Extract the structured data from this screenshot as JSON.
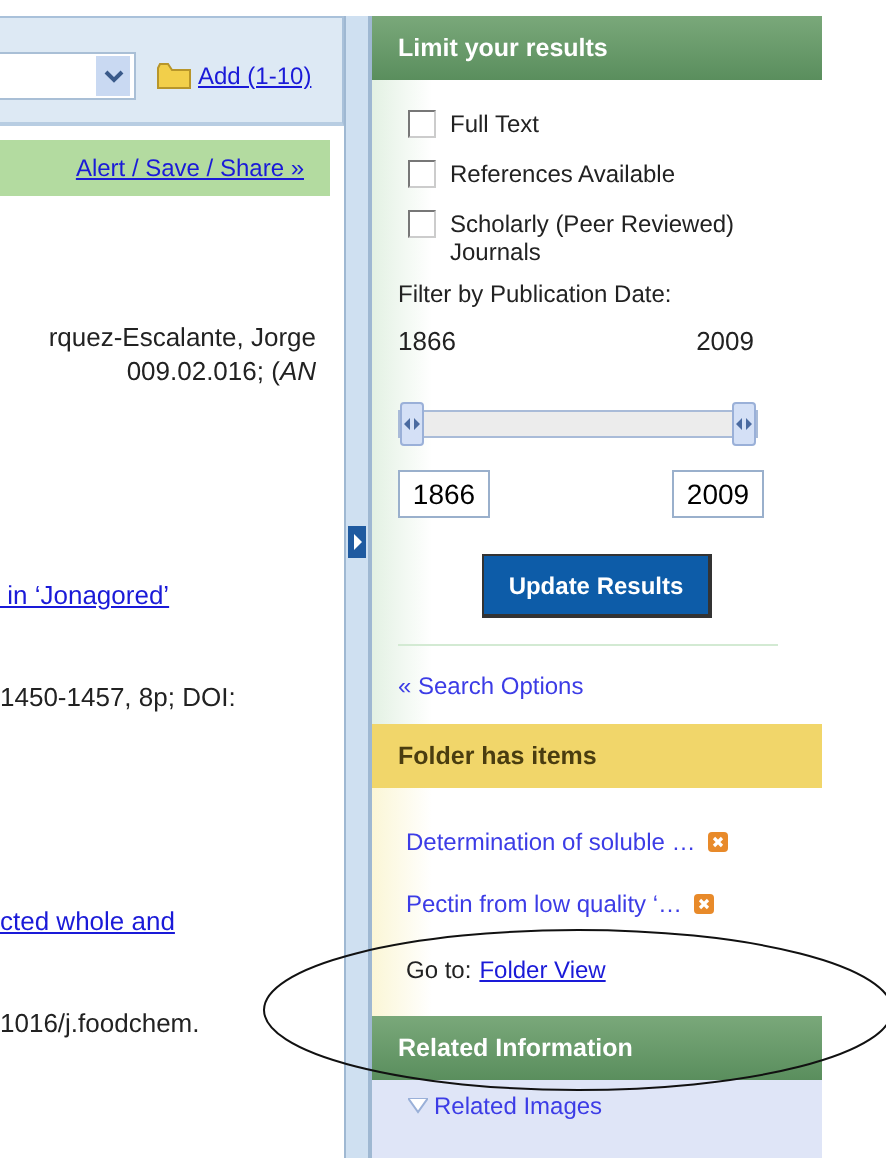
{
  "toolbar": {
    "add_link": "Add (1-10)"
  },
  "action_bar": {
    "link": "Alert / Save / Share »"
  },
  "results": [
    {
      "lines": [
        {
          "kind": "text",
          "text": "rquez-Escalante, Jorge"
        },
        {
          "kind": "text",
          "text": "009.02.016; (*AN*"
        }
      ]
    },
    {
      "lines": [
        {
          "kind": "link",
          "text": " in ‘Jonagored’"
        },
        {
          "kind": "text",
          "text": "1450-1457, 8p; DOI:"
        }
      ]
    },
    {
      "lines": [
        {
          "kind": "link",
          "text": "cted whole and"
        },
        {
          "kind": "text",
          "text": "1016/j.foodchem."
        }
      ]
    }
  ],
  "limit_panel": {
    "title": "Limit your results",
    "checkboxes": [
      {
        "label": "Full Text",
        "checked": false
      },
      {
        "label": "References Available",
        "checked": false
      },
      {
        "label": "Scholarly (Peer Reviewed) Journals",
        "checked": false
      }
    ],
    "date_filter": {
      "label": "Filter by Publication Date:",
      "min_label": "1866",
      "max_label": "2009",
      "slider": {
        "thumbs": [
          {
            "level": 0
          },
          {
            "level": 1
          }
        ]
      },
      "from_value": "1866",
      "to_value": "2009"
    },
    "button": "Update Results",
    "search_options_link": "« Search Options"
  },
  "folder_panel": {
    "title": "Folder has items",
    "items": [
      {
        "text": "Determination of soluble …"
      },
      {
        "text": "Pectin from low quality ‘…"
      }
    ],
    "goto_label": "Go to:",
    "goto_link": "Folder View"
  },
  "related_panel": {
    "title": "Related Information",
    "items": [
      {
        "text": "Related Images",
        "expanded": false
      }
    ]
  }
}
